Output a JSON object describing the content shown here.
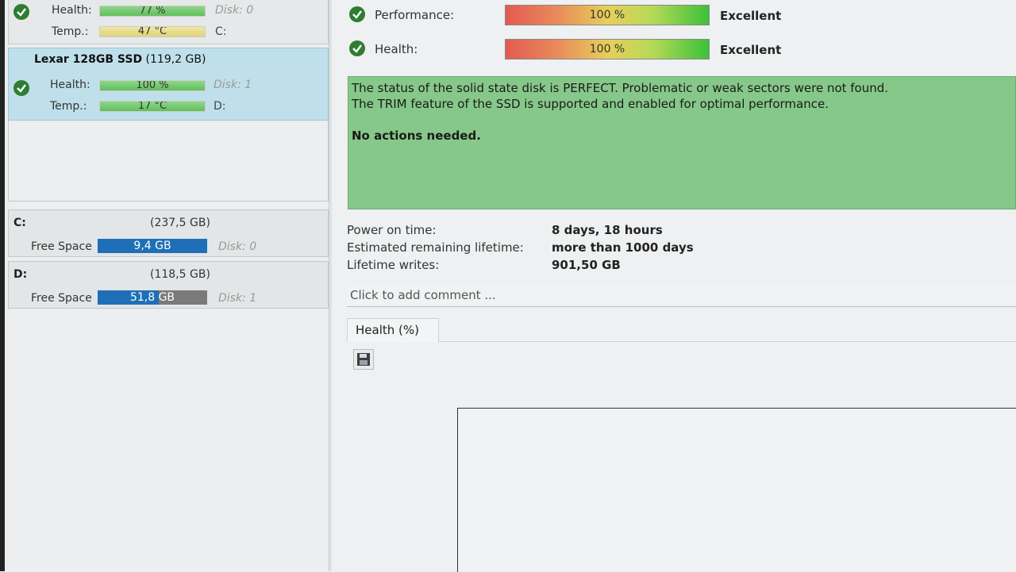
{
  "disks": [
    {
      "title_bold": "",
      "title_size": "",
      "health_label": "Health:",
      "health_value": "77 %",
      "health_fill": 0.77,
      "temp_label": "Temp.:",
      "temp_value": "47 °C",
      "temp_fill": 1.0,
      "disk_num": "Disk: 0",
      "drive": "C:"
    },
    {
      "title_bold": "Lexar 128GB SSD",
      "title_size": "(119,2 GB)",
      "health_label": "Health:",
      "health_value": "100 %",
      "health_fill": 1.0,
      "temp_label": "Temp.:",
      "temp_value": "17 °C",
      "temp_fill": 1.0,
      "disk_num": "Disk: 1",
      "drive": "D:"
    }
  ],
  "volumes": [
    {
      "letter": "C:",
      "size": "(237,5 GB)",
      "free_label": "Free Space",
      "free_value": "9,4 GB",
      "used_fraction": 1.0,
      "disk": "Disk: 0"
    },
    {
      "letter": "D:",
      "size": "(118,5 GB)",
      "free_label": "Free Space",
      "free_value": "51,8 GB",
      "used_fraction": 0.56,
      "disk": "Disk: 1"
    }
  ],
  "ratings": [
    {
      "label": "Performance:",
      "value": "100 %",
      "verdict": "Excellent"
    },
    {
      "label": "Health:",
      "value": "100 %",
      "verdict": "Excellent"
    }
  ],
  "status": {
    "line1": "The status of the solid state disk is PERFECT. Problematic or weak sectors were not found.",
    "line2": "The TRIM feature of the SSD is supported and enabled for optimal performance.",
    "line3": "No actions needed."
  },
  "info": [
    {
      "label": "Power on time:",
      "value": "8 days, 18 hours"
    },
    {
      "label": "Estimated remaining lifetime:",
      "value": "more than 1000 days"
    },
    {
      "label": "Lifetime writes:",
      "value": "901,50 GB"
    }
  ],
  "comment": {
    "placeholder": "Click to add comment ..."
  },
  "tab": {
    "label": "Health (%)"
  },
  "colors": {
    "status_bg": "#86c889",
    "selected_bg": "#bfe0ea",
    "volume_bar": "#1f6fb8"
  }
}
